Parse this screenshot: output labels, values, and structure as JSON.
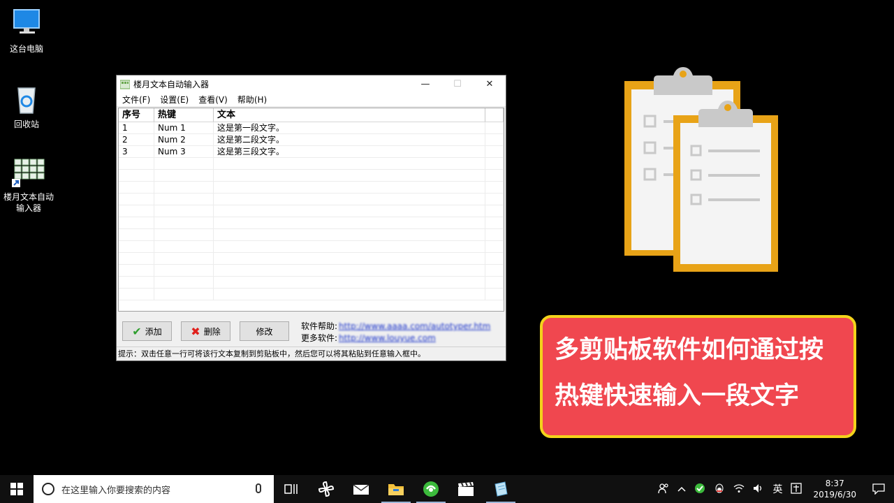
{
  "desktop": {
    "icons": [
      {
        "label": "这台电脑"
      },
      {
        "label": "回收站"
      },
      {
        "label_line1": "楼月文本自动",
        "label_line2": "输入器"
      }
    ]
  },
  "window": {
    "title": "楼月文本自动输入器",
    "controls": {
      "minimize": "—",
      "maximize": "☐",
      "close": "✕"
    },
    "menu": [
      "文件(F)",
      "设置(E)",
      "查看(V)",
      "帮助(H)"
    ],
    "table": {
      "columns": [
        "序号",
        "热键",
        "文本"
      ],
      "rows": [
        {
          "no": "1",
          "hotkey": "Num 1",
          "text": "这是第一段文字。"
        },
        {
          "no": "2",
          "hotkey": "Num 2",
          "text": "这是第二段文字。"
        },
        {
          "no": "3",
          "hotkey": "Num 3",
          "text": "这是第三段文字。"
        }
      ]
    },
    "buttons": {
      "add": "添加",
      "delete": "删除",
      "edit": "修改"
    },
    "links": {
      "help_label": "软件帮助:",
      "help_url": "http://www.aaaa.com/autotyper.htm",
      "more_label": "更多软件:",
      "more_url": "http://www.louyue.com"
    },
    "status": "提示：双击任意一行可将该行文本复制到剪贴板中，然后您可以将其粘贴到任意输入框中。"
  },
  "banner": {
    "line1": "多剪贴板软件如何通过按",
    "line2": "热键快速输入一段文字",
    "colors": {
      "background": "#f0474f",
      "border": "#f3d31b"
    }
  },
  "taskbar": {
    "search_placeholder": "在这里输入你要搜索的内容",
    "tray": {
      "ime": "英",
      "time": "8:37",
      "date": "2019/6/30"
    }
  }
}
